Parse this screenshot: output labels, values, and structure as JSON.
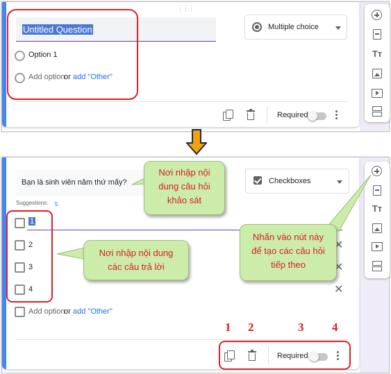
{
  "top_card": {
    "question_title": "Untitled Question",
    "type_select": "Multiple choice",
    "option_1": "Option 1",
    "add_option": "Add option",
    "or_text": "or",
    "add_other": "add \"Other\"",
    "required_label": "Required"
  },
  "bottom_card": {
    "question_text": "Bạn là sinh viên năm thứ mấy?",
    "type_select": "Checkboxes",
    "suggestions_label": "Suggestions:",
    "suggestions_value": "5",
    "options": [
      "1",
      "2",
      "3",
      "4"
    ],
    "add_option": "Add option",
    "or_text": "or",
    "add_other": "add \"Other\"",
    "required_label": "Required"
  },
  "callouts": {
    "question_entry": "Nơi nhập nội dung câu hỏi khảo sát",
    "answers_entry": "Nơi nhập nội dung các câu trả lời",
    "add_button": "Nhấn vào nút này để tạo các câu hỏi tiếp theo"
  },
  "numbers": [
    "1",
    "2",
    "3",
    "4"
  ],
  "sidebar_icons": [
    "add-question-icon",
    "import-questions-icon",
    "add-title-icon",
    "add-image-icon",
    "add-video-icon",
    "add-section-icon"
  ],
  "colors": {
    "accent": "#4285f4",
    "link": "#1a73e8",
    "annotation_red": "#e21d25",
    "callout_fill": "#ccecaa",
    "arrow": "#f2a20c"
  }
}
